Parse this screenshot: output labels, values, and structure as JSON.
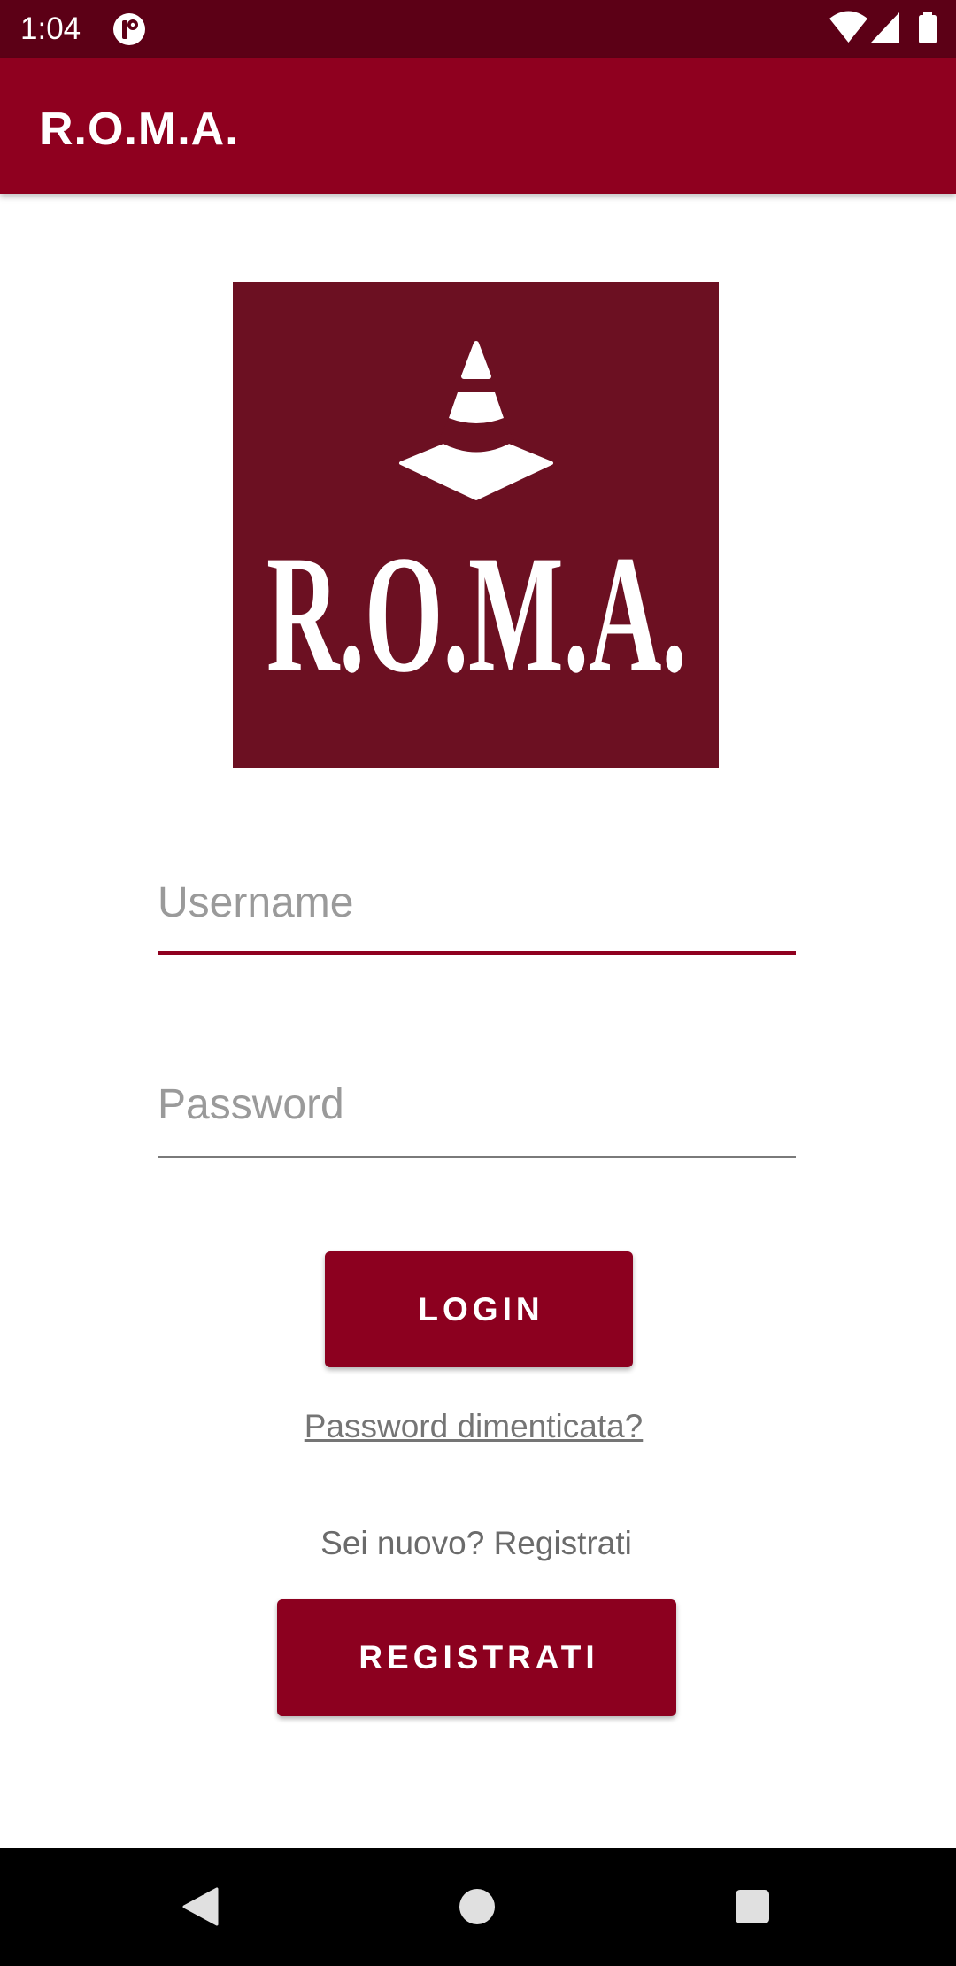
{
  "status_bar": {
    "time": "1:04",
    "icons": {
      "notification": "app-notification-icon",
      "wifi": "wifi-icon",
      "signal": "cellular-signal-icon",
      "battery": "battery-icon"
    }
  },
  "app_bar": {
    "title": "R.O.M.A."
  },
  "logo": {
    "text": "R.O.M.A.",
    "icon": "traffic-cone-icon"
  },
  "login_form": {
    "username": {
      "value": "",
      "placeholder": "Username"
    },
    "password": {
      "value": "",
      "placeholder": "Password"
    },
    "login_button": "LOGIN",
    "forgot_password_link": "Password dimenticata?",
    "register_prompt": "Sei nuovo? Registrati",
    "register_button": "REGISTRATI"
  },
  "nav_bar": {
    "icons": [
      "back-icon",
      "home-icon",
      "recents-icon"
    ]
  },
  "colors": {
    "status_bar": "#5c0016",
    "app_bar": "#8f001f",
    "logo_background": "#6c1022",
    "accent": "#8c001f",
    "on_accent": "#ffffff",
    "hint_text": "#9a9a9a",
    "link_text": "#757575"
  }
}
